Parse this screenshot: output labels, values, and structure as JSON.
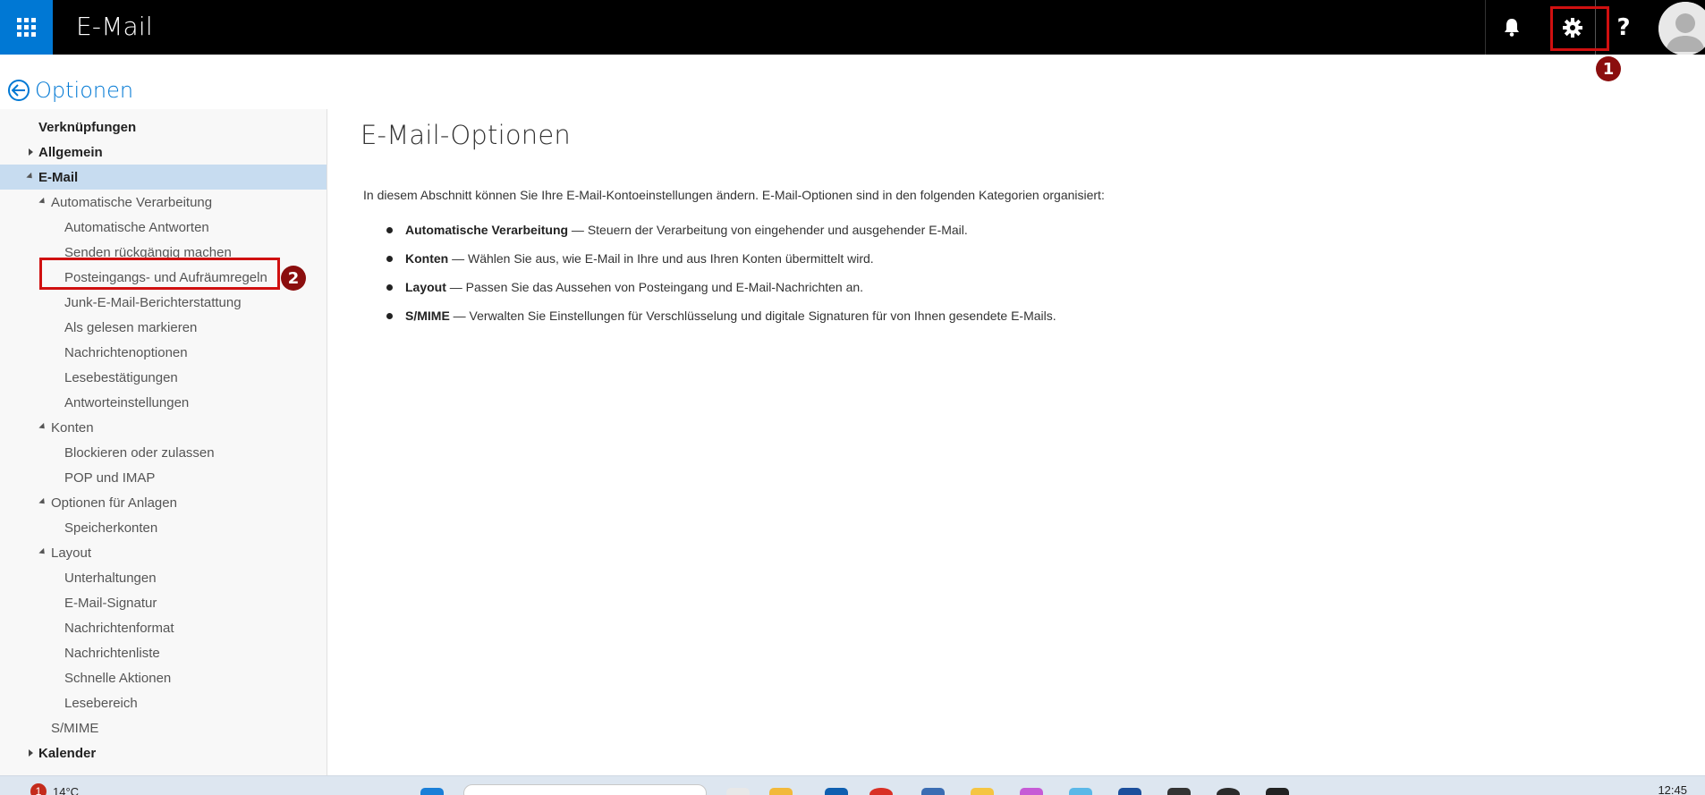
{
  "app": {
    "title": "E-Mail"
  },
  "topbar": {
    "icons": [
      "waffle-icon",
      "bell-icon",
      "gear-icon",
      "help-icon",
      "avatar-icon"
    ],
    "help_label": "?"
  },
  "annotations": {
    "badge1": "1",
    "badge2": "2",
    "color": "#d01010"
  },
  "options": {
    "title": "Optionen"
  },
  "sidebar": {
    "items": [
      {
        "label": "Verknüpfungen"
      },
      {
        "label": "Allgemein"
      },
      {
        "label": "E-Mail"
      },
      {
        "label": "Automatische Verarbeitung"
      },
      {
        "label": "Automatische Antworten"
      },
      {
        "label": "Senden rückgängig machen"
      },
      {
        "label": "Posteingangs- und Aufräumregeln"
      },
      {
        "label": "Junk-E-Mail-Berichterstattung"
      },
      {
        "label": "Als gelesen markieren"
      },
      {
        "label": "Nachrichtenoptionen"
      },
      {
        "label": "Lesebestätigungen"
      },
      {
        "label": "Antworteinstellungen"
      },
      {
        "label": "Konten"
      },
      {
        "label": "Blockieren oder zulassen"
      },
      {
        "label": "POP und IMAP"
      },
      {
        "label": "Optionen für Anlagen"
      },
      {
        "label": "Speicherkonten"
      },
      {
        "label": "Layout"
      },
      {
        "label": "Unterhaltungen"
      },
      {
        "label": "E-Mail-Signatur"
      },
      {
        "label": "Nachrichtenformat"
      },
      {
        "label": "Nachrichtenliste"
      },
      {
        "label": "Schnelle Aktionen"
      },
      {
        "label": "Lesebereich"
      },
      {
        "label": "S/MIME"
      },
      {
        "label": "Kalender"
      }
    ]
  },
  "main": {
    "title": "E-Mail-Optionen",
    "intro": "In diesem Abschnitt können Sie Ihre E-Mail-Kontoeinstellungen ändern. E-Mail-Optionen sind in den folgenden Kategorien organisiert:",
    "bullets": [
      {
        "term": "Automatische Verarbeitung",
        "text": " — Steuern der Verarbeitung von eingehender und ausgehender E-Mail."
      },
      {
        "term": "Konten",
        "text": " — Wählen Sie aus, wie E-Mail in Ihre und aus Ihren Konten übermittelt wird."
      },
      {
        "term": "Layout",
        "text": " — Passen Sie das Aussehen von Posteingang und E-Mail-Nachrichten an."
      },
      {
        "term": "S/MIME",
        "text": " — Verwalten Sie Einstellungen für Verschlüsselung und digitale Signaturen für von Ihnen gesendete E-Mails."
      }
    ]
  },
  "taskbar": {
    "weather_badge": "1",
    "temperature": "14°C",
    "time": "12:45"
  },
  "colors": {
    "accent": "#0078d4",
    "topbar": "#000000",
    "selected": "#c7dcf0"
  }
}
